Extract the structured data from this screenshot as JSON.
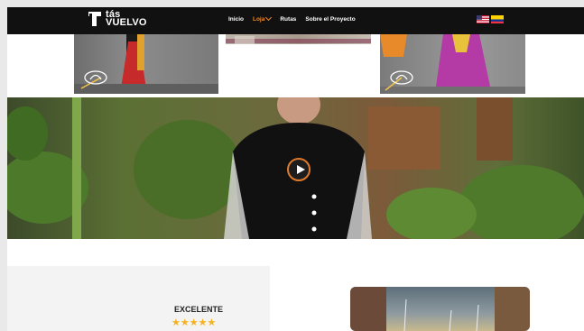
{
  "brand": {
    "line1": "tás",
    "line2": "VUELVO"
  },
  "nav": {
    "items": [
      {
        "label": "Inicio",
        "active": false
      },
      {
        "label": "Loja",
        "active": true,
        "has_dropdown": true
      },
      {
        "label": "Rutas",
        "active": false
      },
      {
        "label": "Sobre el Proyecto",
        "active": false
      }
    ],
    "languages": [
      "us-flag-icon",
      "ecuador-flag-icon"
    ]
  },
  "gallery": {
    "items": [
      "gallery-photo-dancer-red",
      "gallery-photo-textile",
      "gallery-photo-dancer-purple"
    ]
  },
  "hero": {
    "play_icon": "play-icon"
  },
  "review": {
    "label": "EXCELENTE",
    "stars": "★★★★★",
    "rating": 4.5
  },
  "colors": {
    "nav_bg": "#111111",
    "accent": "#f08a2c",
    "star": "#f5b21e"
  }
}
